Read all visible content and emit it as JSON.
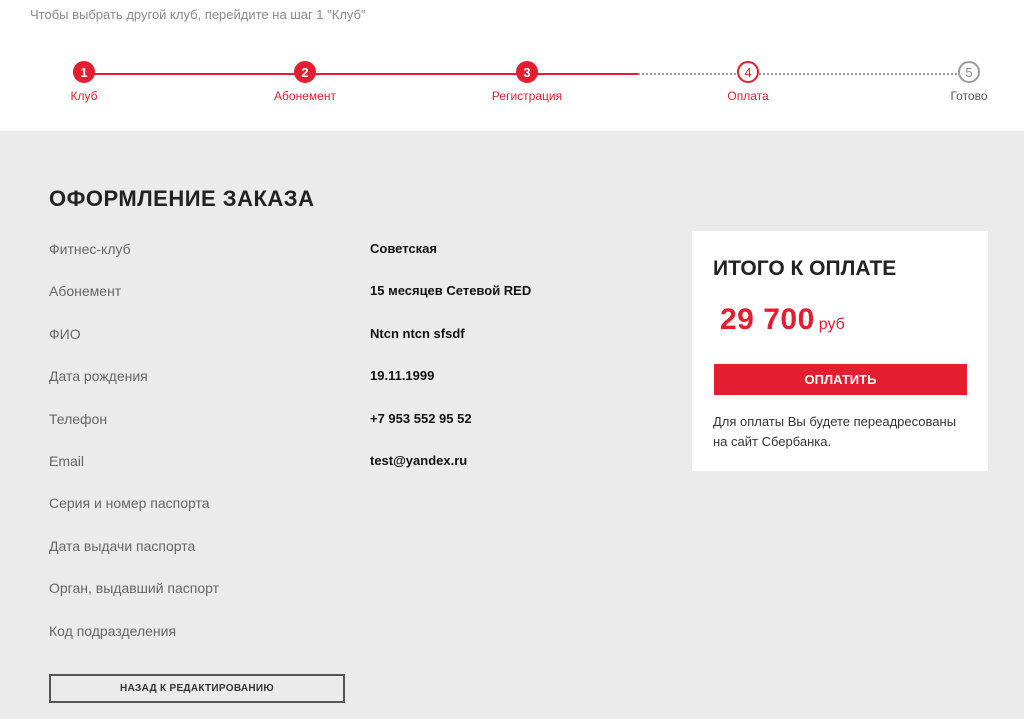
{
  "hint": "Чтобы выбрать другой клуб, перейдите на шаг 1 \"Клуб\"",
  "steps": [
    {
      "number": "1",
      "label": "Клуб",
      "state": "done"
    },
    {
      "number": "2",
      "label": "Абонемент",
      "state": "done"
    },
    {
      "number": "3",
      "label": "Регистрация",
      "state": "done"
    },
    {
      "number": "4",
      "label": "Оплата",
      "state": "current"
    },
    {
      "number": "5",
      "label": "Готово",
      "state": "pending"
    }
  ],
  "order": {
    "title": "ОФОРМЛЕНИЕ ЗАКАЗА",
    "fields": [
      {
        "label": "Фитнес-клуб",
        "value": "Советская"
      },
      {
        "label": "Абонемент",
        "value": "15 месяцев Сетевой RED"
      },
      {
        "label": "ФИО",
        "value": "Ntcn ntcn sfsdf"
      },
      {
        "label": "Дата рождения",
        "value": "19.11.1999"
      },
      {
        "label": "Телефон",
        "value": "+7 953 552 95 52"
      },
      {
        "label": "Email",
        "value": "test@yandex.ru"
      },
      {
        "label": "Серия и номер паспорта",
        "value": ""
      },
      {
        "label": "Дата выдачи паспорта",
        "value": ""
      },
      {
        "label": "Орган, выдавший паспорт",
        "value": ""
      },
      {
        "label": "Код подразделения",
        "value": ""
      }
    ],
    "back_label": "НАЗАД К РЕДАКТИРОВАНИЮ"
  },
  "summary": {
    "title": "ИТОГО К ОПЛАТЕ",
    "amount": "29 700",
    "currency": "руб",
    "pay_label": "ОПЛАТИТЬ",
    "note": "Для оплаты Вы будете переадресованы на сайт Сбербанка."
  },
  "colors": {
    "accent": "#e31e30",
    "background": "#ebebeb",
    "panel": "#ffffff"
  }
}
